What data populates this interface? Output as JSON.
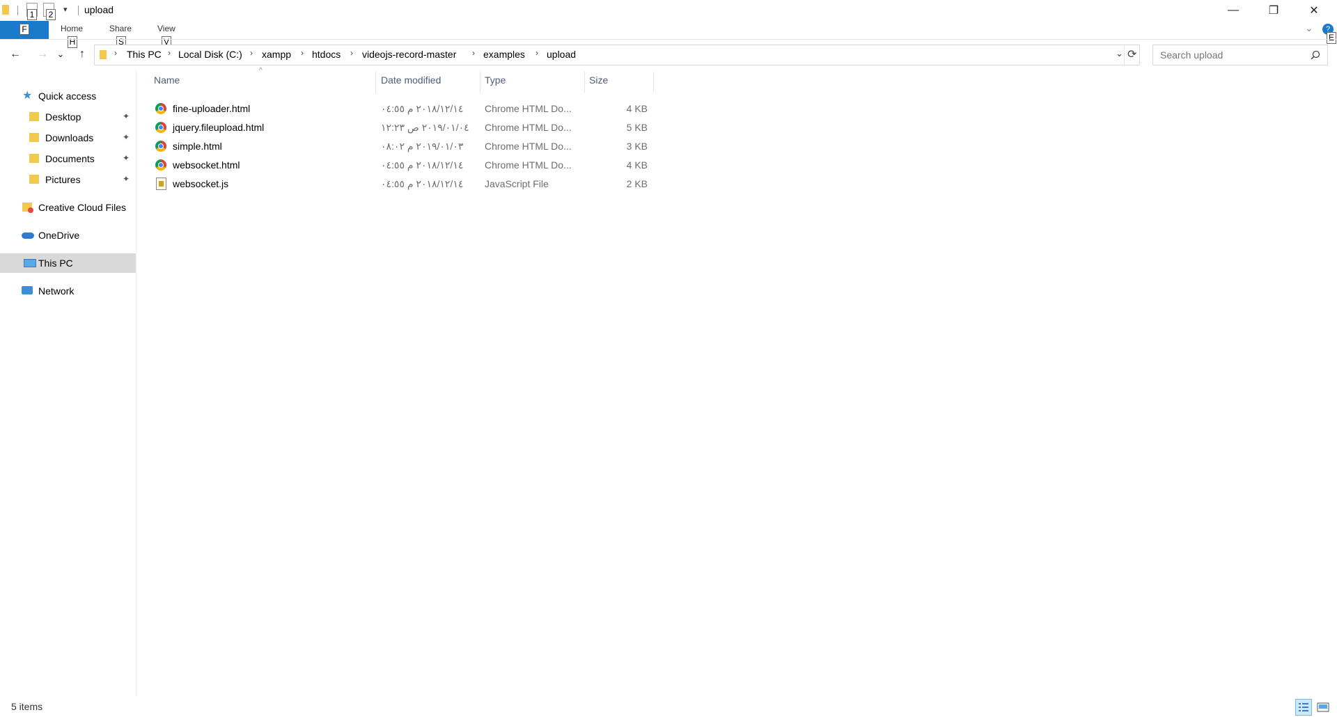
{
  "window": {
    "title": "upload",
    "minimize_glyph": "—",
    "maximize_glyph": "❐",
    "close_glyph": "✕"
  },
  "quick_access_toolbar": {
    "keytip_1": "1",
    "keytip_2": "2",
    "dropdown_glyph": "▾"
  },
  "ribbon": {
    "file_keytip": "F",
    "tabs": [
      {
        "label": "Home",
        "keytip": "H"
      },
      {
        "label": "Share",
        "keytip": "S"
      },
      {
        "label": "View",
        "keytip": "V"
      }
    ],
    "expand_glyph": "⌄",
    "help_keytip": "E"
  },
  "navigation": {
    "back": "←",
    "forward": "→",
    "recent": "⌄",
    "up": "↑",
    "refresh": "⟳",
    "address_dropdown": "⌄"
  },
  "breadcrumb": [
    "This PC",
    "Local Disk (C:)",
    "xampp",
    "htdocs",
    "videojs-record-master",
    "examples",
    "upload"
  ],
  "search": {
    "placeholder": "Search upload",
    "icon": "search-icon"
  },
  "sidebar": {
    "items": [
      {
        "label": "Quick access",
        "icon": "star-icon",
        "color": "#3b8ed8"
      },
      {
        "label": "Desktop",
        "icon": "desktop-folder-icon",
        "pinned": true
      },
      {
        "label": "Downloads",
        "icon": "downloads-folder-icon",
        "pinned": true
      },
      {
        "label": "Documents",
        "icon": "documents-folder-icon",
        "pinned": true
      },
      {
        "label": "Pictures",
        "icon": "pictures-folder-icon",
        "pinned": true
      },
      {
        "label": "Creative Cloud Files",
        "icon": "creative-cloud-icon",
        "color": "#e34b3c"
      },
      {
        "label": "OneDrive",
        "icon": "onedrive-icon",
        "color": "#2f7dd1"
      },
      {
        "label": "This PC",
        "icon": "computer-icon",
        "selected": true
      },
      {
        "label": "Network",
        "icon": "network-icon"
      }
    ],
    "pin_glyph": "📌"
  },
  "columns": {
    "name": "Name",
    "date": "Date modified",
    "type": "Type",
    "size": "Size",
    "sort_glyph": "^"
  },
  "files": [
    {
      "name": "fine-uploader.html",
      "date": "٢٠١٨/١٢/١٤ م ٠٤:٥٥",
      "type": "Chrome HTML Do...",
      "size": "4 KB",
      "icon": "chrome-icon"
    },
    {
      "name": "jquery.fileupload.html",
      "date": "٢٠١٩/٠١/٠٤ ص ١٢:٢٣",
      "type": "Chrome HTML Do...",
      "size": "5 KB",
      "icon": "chrome-icon"
    },
    {
      "name": "simple.html",
      "date": "٢٠١٩/٠١/٠٣ م ٠٨:٠٢",
      "type": "Chrome HTML Do...",
      "size": "3 KB",
      "icon": "chrome-icon"
    },
    {
      "name": "websocket.html",
      "date": "٢٠١٨/١٢/١٤ م ٠٤:٥٥",
      "type": "Chrome HTML Do...",
      "size": "4 KB",
      "icon": "chrome-icon"
    },
    {
      "name": "websocket.js",
      "date": "٢٠١٨/١٢/١٤ م ٠٤:٥٥",
      "type": "JavaScript File",
      "size": "2 KB",
      "icon": "javascript-file-icon"
    }
  ],
  "status": {
    "item_count": "5 items"
  },
  "colors": {
    "accent": "#1979ca",
    "selected_bg": "#d9d9d9",
    "header_text": "#4d5d7a"
  }
}
